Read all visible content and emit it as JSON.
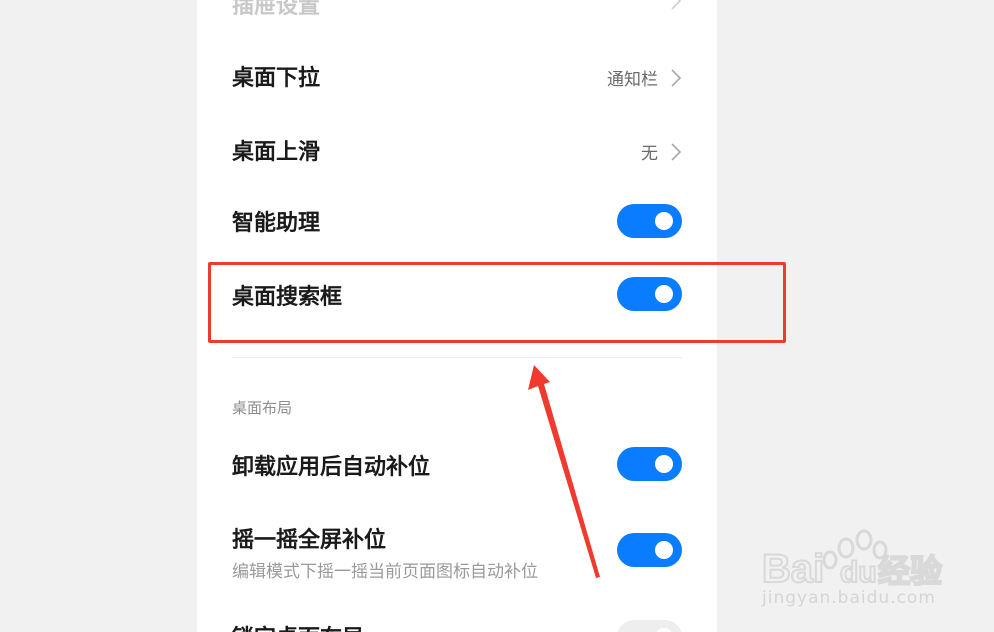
{
  "settings": {
    "top_partial_label": "插屉设置",
    "items": [
      {
        "label": "桌面下拉",
        "value": "通知栏",
        "type": "nav"
      },
      {
        "label": "桌面上滑",
        "value": "无",
        "type": "nav"
      },
      {
        "label": "智能助理",
        "type": "toggle",
        "on": true
      },
      {
        "label": "桌面搜索框",
        "type": "toggle",
        "on": true
      }
    ],
    "section_header": "桌面布局",
    "layout_items": [
      {
        "label": "卸载应用后自动补位",
        "type": "toggle",
        "on": true
      },
      {
        "label": "摇一摇全屏补位",
        "sublabel": "编辑模式下摇一摇当前页面图标自动补位",
        "type": "toggle",
        "on": true
      },
      {
        "label": "锁定桌面布局",
        "type": "toggle",
        "on": false
      }
    ]
  },
  "watermark": {
    "brand": "Bai",
    "brand_suffix": "du",
    "product": "经验",
    "url": "jingyan.baidu.com"
  },
  "colors": {
    "accent": "#0a7cff",
    "highlight": "#f03a2e"
  }
}
